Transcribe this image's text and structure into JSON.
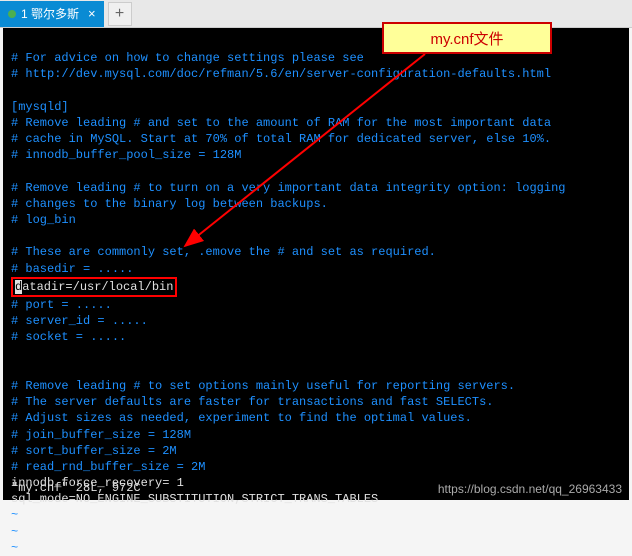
{
  "tab": {
    "label": "1 鄂尔多斯",
    "close": "×",
    "add": "+"
  },
  "callout": "my.cnf文件",
  "file": {
    "lines": {
      "l1": "# For advice on how to change settings please see",
      "l2": "# http://dev.mysql.com/doc/refman/5.6/en/server-configuration-defaults.html",
      "l3": "",
      "l4": "[mysqld]",
      "l5": "# Remove leading # and set to the amount of RAM for the most important data",
      "l6": "# cache in MySQL. Start at 70% of total RAM for dedicated server, else 10%.",
      "l7": "# innodb_buffer_pool_size = 128M",
      "l8": "",
      "l9": "# Remove leading # to turn on a very important data integrity option: logging",
      "l10": "# changes to the binary log between backups.",
      "l11": "# log_bin",
      "l12": "",
      "l13": "# These are commonly set, .emove the # and set as required.",
      "l14": "# basedir = .....",
      "l15a": "d",
      "l15b": "atadir=/usr/local/bin",
      "l16": "# port = .....",
      "l17": "# server_id = .....",
      "l18": "# socket = .....",
      "l19": "",
      "l20": "",
      "l21": "# Remove leading # to set options mainly useful for reporting servers.",
      "l22": "# The server defaults are faster for transactions and fast SELECTs.",
      "l23": "# Adjust sizes as needed, experiment to find the optimal values.",
      "l24": "# join_buffer_size = 128M",
      "l25": "# sort_buffer_size = 2M",
      "l26": "# read_rnd_buffer_size = 2M",
      "l27": "innodb_force_recovery= 1",
      "l28": "sql_mode=NO_ENGINE_SUBSTITUTION,STRICT_TRANS_TABLES",
      "tilde": "~"
    }
  },
  "status": "\"my.cnf\" 28L, 972C",
  "watermark": "https://blog.csdn.net/qq_26963433"
}
